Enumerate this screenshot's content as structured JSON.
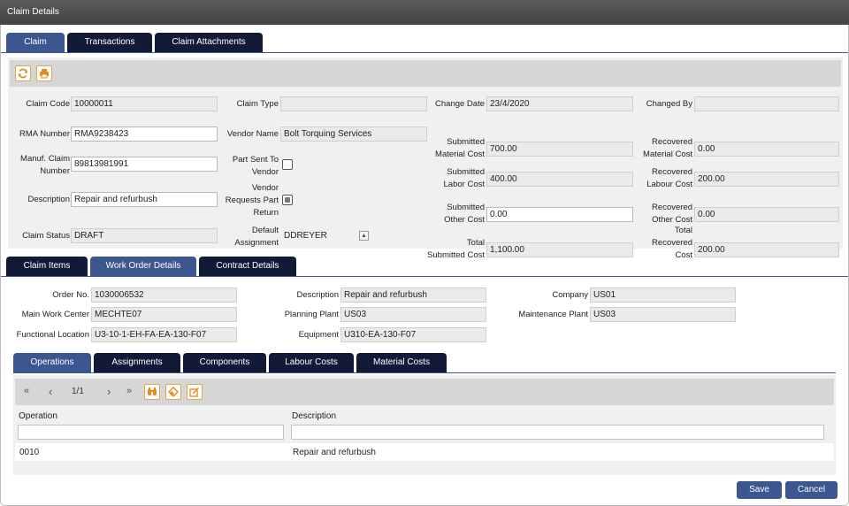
{
  "window": {
    "title": "Claim Details"
  },
  "main_tabs": [
    "Claim",
    "Transactions",
    "Claim Attachments"
  ],
  "claim": {
    "claim_code": {
      "label": "Claim Code",
      "value": "10000011"
    },
    "claim_type": {
      "label": "Claim Type",
      "value": ""
    },
    "change_date": {
      "label": "Change Date",
      "value": "23/4/2020"
    },
    "changed_by": {
      "label": "Changed By",
      "value": ""
    },
    "rma_number": {
      "label": "RMA Number",
      "value": "RMA9238423"
    },
    "vendor_name": {
      "label": "Vendor Name",
      "value": "Bolt Torquing Services"
    },
    "submitted_material_cost": {
      "label_1": "Submitted",
      "label_2": "Material Cost",
      "value": "700.00"
    },
    "recovered_material_cost": {
      "label_1": "Recovered",
      "label_2": "Material Cost",
      "value": "0.00"
    },
    "manuf_claim_number": {
      "label_1": "Manuf. Claim",
      "label_2": "Number",
      "value": "89813981991"
    },
    "part_sent_to_vendor": {
      "label_1": "Part Sent To",
      "label_2": "Vendor",
      "checked": false
    },
    "submitted_labor_cost": {
      "label_1": "Submitted",
      "label_2": "Labor Cost",
      "value": "400.00"
    },
    "recovered_labour_cost": {
      "label_1": "Recovered",
      "label_2": "Labour Cost",
      "value": "200.00"
    },
    "description": {
      "label": "Description",
      "value": "Repair and refurbush"
    },
    "vendor_requests_part_return": {
      "label_1": "Vendor",
      "label_2": "Requests Part",
      "label_3": "Return",
      "checked": true
    },
    "submitted_other_cost": {
      "label_1": "Submitted",
      "label_2": "Other Cost",
      "value": "0.00"
    },
    "recovered_other_cost": {
      "label_1": "Recovered",
      "label_2": "Other Cost",
      "value": "0.00"
    },
    "claim_status": {
      "label": "Claim Status",
      "value": "DRAFT"
    },
    "default_assignment": {
      "label_1": "Default",
      "label_2": "Assignment",
      "value": "DDREYER"
    },
    "total_submitted_cost": {
      "label_1": "Total",
      "label_2": "Submitted Cost",
      "value": "1,100.00"
    },
    "total_recovered_cost": {
      "label_1": "Total",
      "label_2": "Recovered Cost",
      "value": "200.00"
    }
  },
  "sub_tabs": [
    "Claim Items",
    "Work Order Details",
    "Contract Details"
  ],
  "work_order": {
    "order_no": {
      "label": "Order No.",
      "value": "1030006532"
    },
    "description": {
      "label": "Description",
      "value": "Repair and refurbush"
    },
    "company": {
      "label": "Company",
      "value": "US01"
    },
    "main_work_center": {
      "label": "Main Work Center",
      "value": "MECHTE07"
    },
    "planning_plant": {
      "label": "Planning Plant",
      "value": "US03"
    },
    "maintenance_plant": {
      "label": "Maintenance Plant",
      "value": "US03"
    },
    "functional_location": {
      "label": "Functional Location",
      "value": "U3-10-1-EH-FA-EA-130-F07"
    },
    "equipment": {
      "label": "Equipment",
      "value": "U310-EA-130-F07"
    }
  },
  "inner_tabs": [
    "Operations",
    "Assignments",
    "Components",
    "Labour Costs",
    "Material Costs"
  ],
  "operations": {
    "pager": {
      "first": "«",
      "prev": "‹",
      "page": "1/1",
      "next": "›",
      "last": "»"
    },
    "columns": [
      "Operation",
      "Description"
    ],
    "rows": [
      {
        "operation": "0010",
        "description": "Repair and refurbush"
      }
    ]
  },
  "footer": {
    "save": "Save",
    "cancel": "Cancel"
  },
  "colors": {
    "tab_active": "#3c5690",
    "tab_inactive": "#131a38",
    "icon_orange": "#e8891c"
  }
}
